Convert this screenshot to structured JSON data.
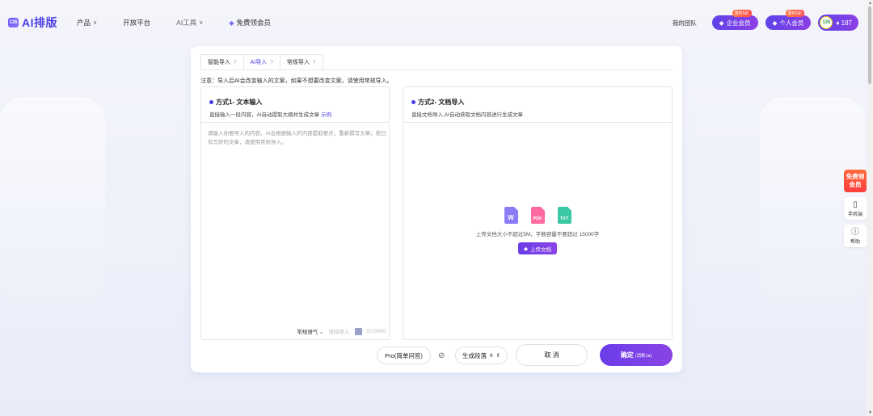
{
  "header": {
    "logo_mark": "135",
    "logo_text": "AI排版",
    "nav": [
      {
        "label": "产品",
        "chevron": "∨"
      },
      {
        "label": "开放平台"
      },
      {
        "label": "AI工具",
        "chevron": "∨"
      },
      {
        "label": "免费领会员",
        "icon": "diamond-icon"
      }
    ],
    "team": "我的团队",
    "enterprise_vip": {
      "label": "企业会员",
      "tag": "限时5折"
    },
    "personal_vip": {
      "label": "个人会员",
      "tag": "限时5折"
    },
    "points": {
      "avatar": "135",
      "value": "♦ 187"
    }
  },
  "tabs": [
    {
      "label": "智能导入"
    },
    {
      "label": "AI导入",
      "active": true
    },
    {
      "label": "常规导入"
    }
  ],
  "notice": "注意：导入后AI会改变输入的文案，如果不想要改变文案，请使用常规导入。",
  "method1": {
    "title": "方式1- 文本输入",
    "subtitle": "直接输入一段内容，AI自动提取大纲并生成文章",
    "example_link": "示例",
    "placeholder": "请输入你要导入的内容，AI会根据输入的内容提取要点，重新撰写文章；若已有写好的文章，请使用常规导入。",
    "tone": "常规语气",
    "clear": "清除导入",
    "count": "0/15000"
  },
  "method2": {
    "title": "方式2- 文档导入",
    "subtitle": "直接文档导入,AI自动获取文档内容进行生成文章",
    "file_types": [
      "W",
      "PDF",
      "TXT"
    ],
    "hint": "上传文档大小不超过5M，字数容量不要超过 15000字",
    "upload_button": "上传文档"
  },
  "controls": {
    "pro": "Pro(简单问答)",
    "generate_label": "生成段落",
    "generate_count": "6",
    "cancel": "取 消",
    "confirm": "确定",
    "confirm_cost": "(消耗1♦)"
  },
  "float_panel": {
    "free": "免费领会员",
    "mobile": "手机端",
    "help": "帮助"
  },
  "colors": {
    "accent": "#4a3fe6",
    "vip_gradient_start": "#5d43e8",
    "vip_gradient_end": "#8d40e6",
    "promo": "#ff4d4f"
  }
}
